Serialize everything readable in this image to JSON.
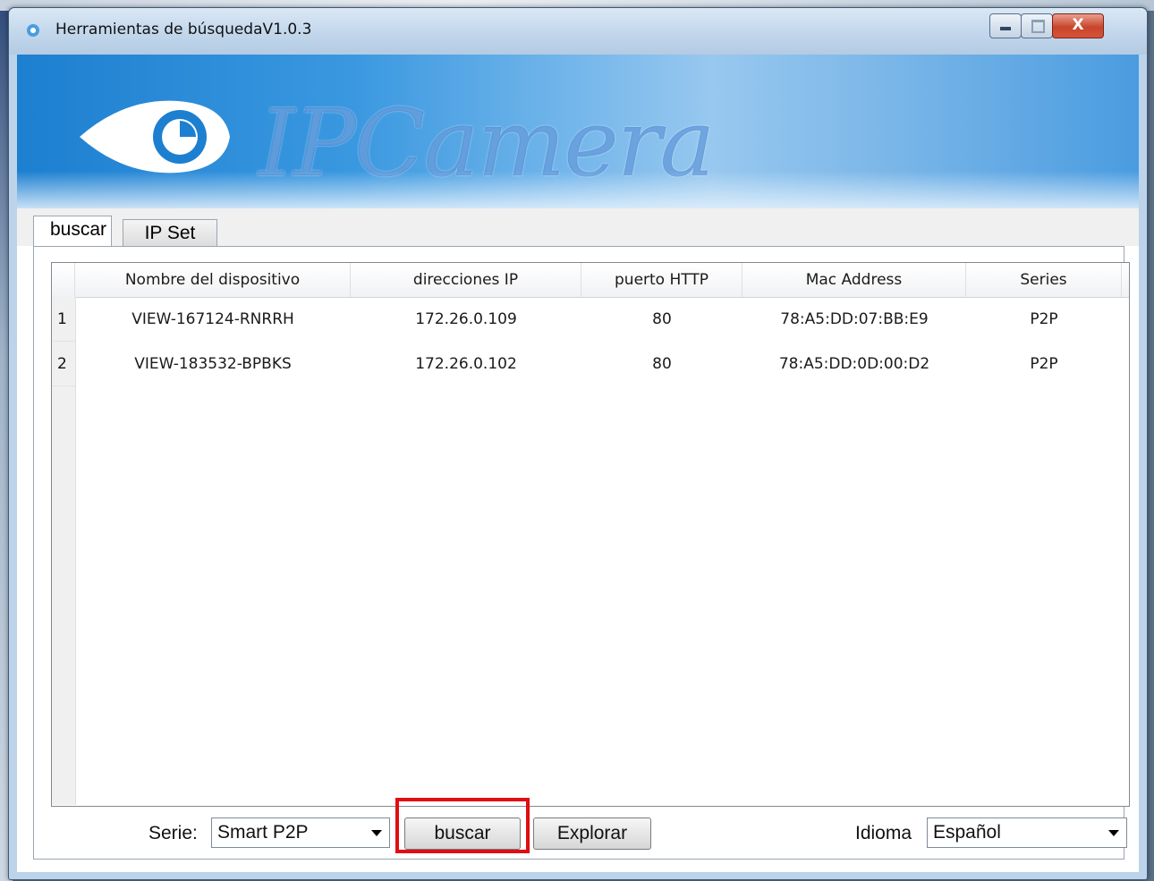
{
  "window": {
    "title": "Herramientas de búsquedaV1.0.3",
    "close_label": "X"
  },
  "banner": {
    "logo_text": "IPCamera",
    "accent_color": "#1d7fd0"
  },
  "tabs": [
    {
      "label": "buscar",
      "active": true
    },
    {
      "label": "IP Set",
      "active": false
    }
  ],
  "table": {
    "columns": [
      "Nombre del dispositivo",
      "direcciones IP",
      "puerto HTTP",
      "Mac Address",
      "Series"
    ],
    "rows": [
      {
        "num": "1",
        "name": "VIEW-167124-RNRRH",
        "ip": "172.26.0.109",
        "port": "80",
        "mac": "78:A5:DD:07:BB:E9",
        "series": "P2P"
      },
      {
        "num": "2",
        "name": "VIEW-183532-BPBKS",
        "ip": "172.26.0.102",
        "port": "80",
        "mac": "78:A5:DD:0D:00:D2",
        "series": "P2P"
      }
    ]
  },
  "bottom": {
    "serie_label": "Serie:",
    "serie_value": "Smart P2P",
    "search_button": "buscar",
    "explore_button": "Explorar",
    "language_label": "Idioma",
    "language_value": "Español",
    "highlight_color": "#e00d13"
  }
}
